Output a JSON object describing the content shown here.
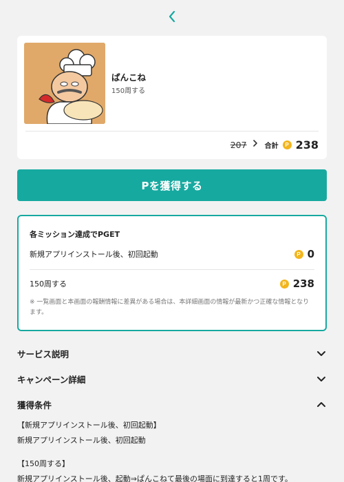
{
  "header": {
    "back_icon": "chevron-left-icon"
  },
  "app": {
    "name": "ぱんこね",
    "subtitle": "150周する",
    "old_points": "207",
    "total_label": "合計",
    "coin_symbol": "P",
    "total_points": "238"
  },
  "cta": {
    "label": "Pを獲得する"
  },
  "missions": {
    "title": "各ミッション達成でPGET",
    "items": [
      {
        "label": "新規アプリインストール後、初回起動",
        "points": "0"
      },
      {
        "label": "150周する",
        "points": "238"
      }
    ],
    "note": "※ 一覧画面と本画面の報酬情報に差異がある場合は、本詳細画面の情報が最新かつ正確な情報となります。"
  },
  "sections": [
    {
      "title": "サービス説明",
      "state": "collapsed"
    },
    {
      "title": "キャンペーン詳細",
      "state": "collapsed"
    },
    {
      "title": "獲得条件",
      "state": "expanded"
    }
  ],
  "conditions": {
    "lines": [
      "【新規アプリインストール後、初回起動】",
      "新規アプリインストール後、初回起動",
      "【150周する】",
      "新規アプリインストール後、起動⇒ぱんこねて最後の場面に到達すると1周です。"
    ]
  },
  "colors": {
    "accent": "#16a9a0",
    "coin": "#f2b51d",
    "background": "#f2f2f2"
  }
}
